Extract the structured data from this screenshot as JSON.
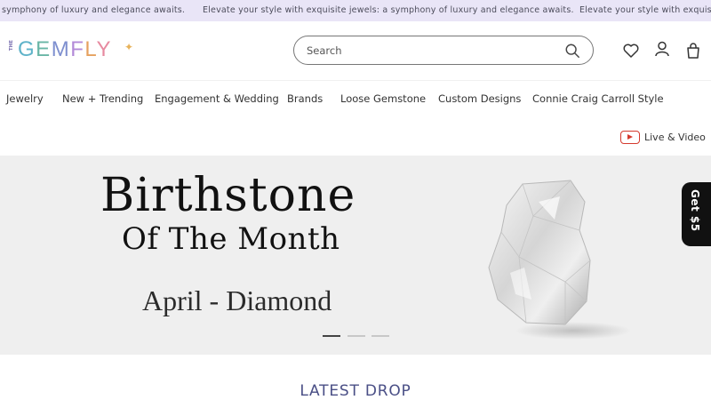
{
  "announcement": {
    "text_left": "symphony of luxury and elegance awaits.",
    "text_middle": "Elevate your style with exquisite jewels: a symphony of luxury and elegance awaits.",
    "text_right": "Elevate your style with exquisit"
  },
  "header": {
    "logo_prefix": "THE",
    "logo_word": [
      "G",
      "E",
      "M",
      "F",
      "L",
      "Y"
    ],
    "search_placeholder": "Search",
    "icons": [
      "search-icon",
      "heart-icon",
      "user-icon",
      "bag-icon"
    ]
  },
  "nav": {
    "items": [
      "Jewelry",
      "New + Trending",
      "Engagement & Wedding",
      "Brands",
      "Loose Gemstone",
      "Custom Designs",
      "Connie Craig Carroll Style"
    ],
    "live_label": "Live & Video"
  },
  "hero": {
    "title_line1": "Birthstone",
    "title_line2": "Of The Month",
    "subtitle": "April - Diamond",
    "slides": 3,
    "active_slide": 0
  },
  "promo": {
    "label": "Get $5"
  },
  "section": {
    "title": "LATEST DROP"
  },
  "colors": {
    "announce_bg": "#e9e5f7",
    "section_title": "#4a4f86",
    "youtube_red": "#d43a2e"
  }
}
